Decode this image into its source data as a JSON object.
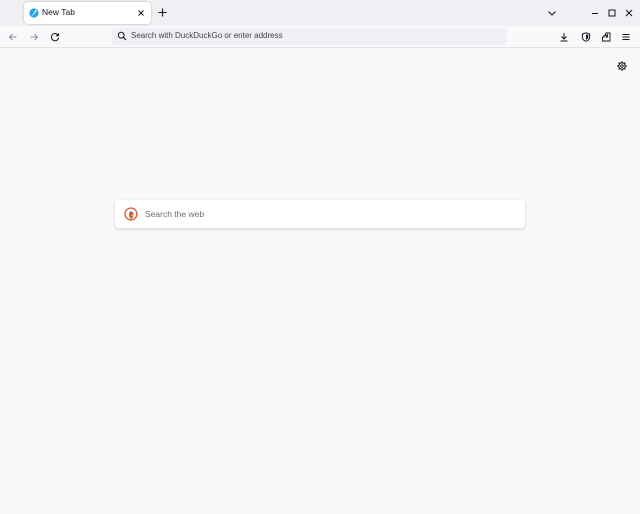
{
  "tabs": [
    {
      "title": "New Tab",
      "favicon": "firefox-favicon-icon",
      "active": true
    }
  ],
  "tabstrip": {
    "new_tab_icon": "plus-icon",
    "list_all_tabs_icon": "chevron-down-icon",
    "window_controls": [
      "minimize-icon",
      "maximize-icon",
      "close-icon"
    ]
  },
  "navigation": {
    "back_icon": "arrow-left-icon",
    "forward_icon": "arrow-right-icon",
    "reload_icon": "reload-icon"
  },
  "urlbar": {
    "placeholder": "Search with DuckDuckGo or enter address",
    "icon": "search-icon"
  },
  "toolbar": {
    "icons": [
      "download-icon",
      "shield-icon",
      "extensions-icon",
      "menu-icon"
    ]
  },
  "newtab_page": {
    "settings_icon": "gear-icon",
    "search": {
      "placeholder": "Search the web",
      "engine_icon": "duckduckgo-logo-icon"
    }
  },
  "colors": {
    "tabstrip_bg": "#f0f0f4",
    "page_bg": "#f9f9fb",
    "urlbar_bg": "#f0f0f4",
    "ddg_orange": "#de5833",
    "firefox_blue": "#2ba5e8"
  }
}
